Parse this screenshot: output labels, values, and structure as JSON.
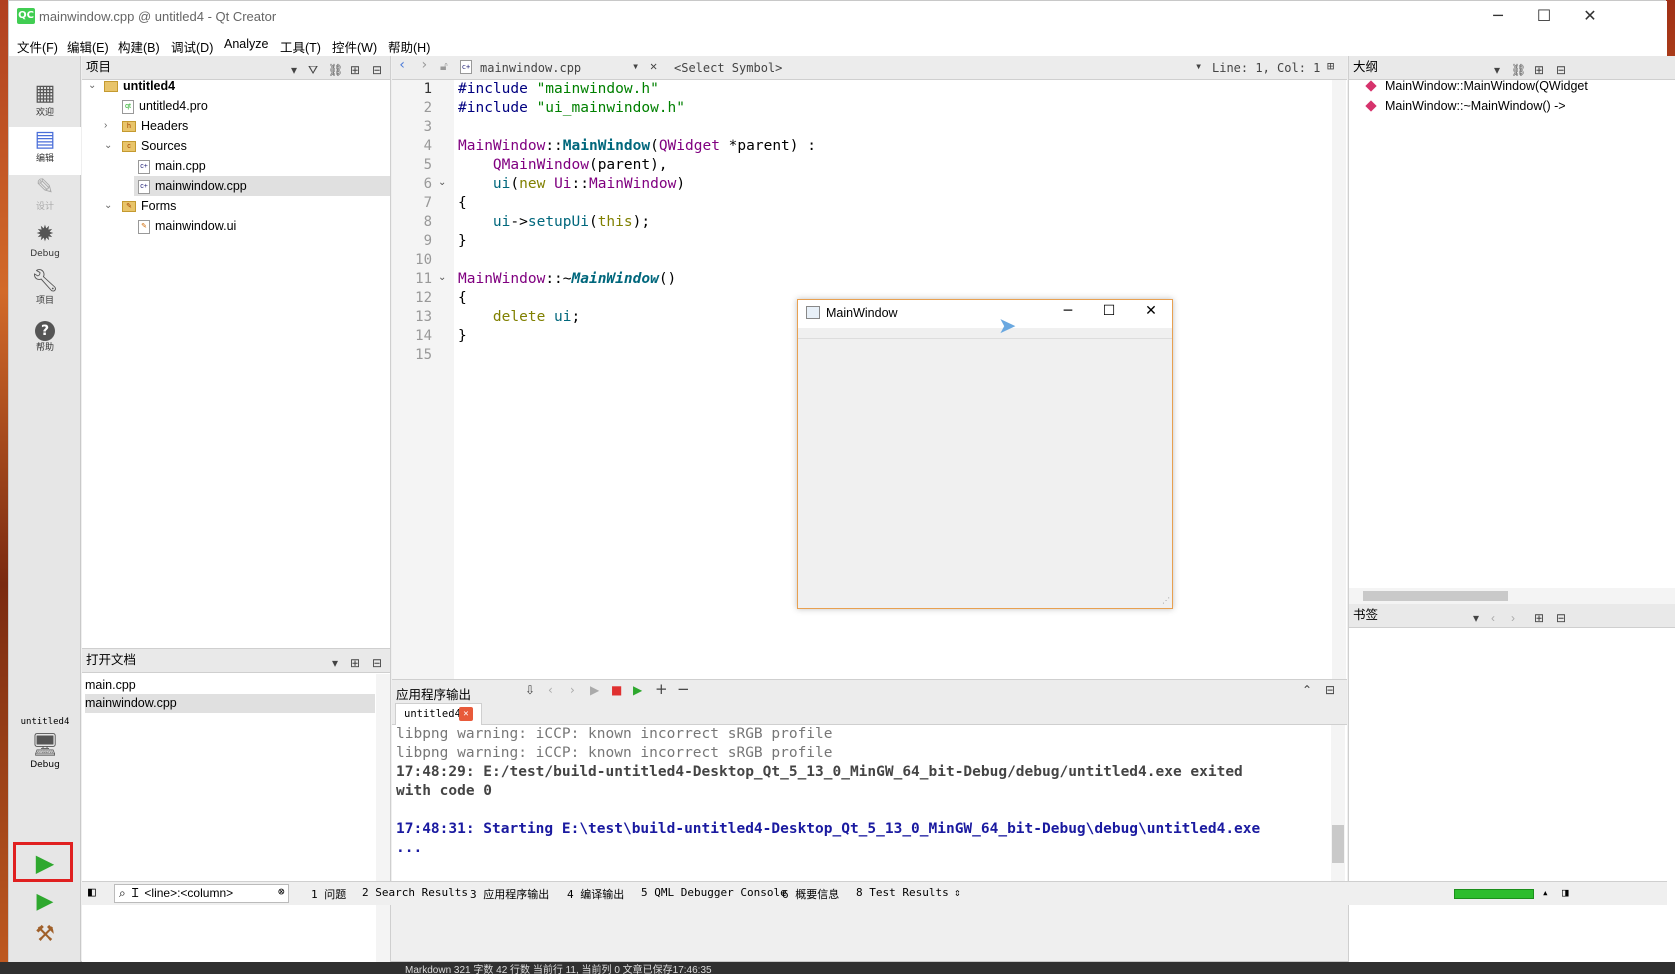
{
  "window": {
    "title": "mainwindow.cpp @ untitled4 - Qt Creator",
    "app_icon": "QC",
    "controls": {
      "minimize": "─",
      "maximize": "☐",
      "close": "✕"
    }
  },
  "menu": [
    "文件(F)",
    "编辑(E)",
    "构建(B)",
    "调试(D)",
    "Analyze",
    "工具(T)",
    "控件(W)",
    "帮助(H)"
  ],
  "modes": [
    {
      "label": "欢迎",
      "icon": "grid-icon"
    },
    {
      "label": "编辑",
      "icon": "edit-icon"
    },
    {
      "label": "设计",
      "icon": "pencil-icon"
    },
    {
      "label": "Debug",
      "icon": "bug-icon"
    },
    {
      "label": "项目",
      "icon": "wrench-icon"
    },
    {
      "label": "帮助",
      "icon": "help-icon"
    }
  ],
  "kit": {
    "project": "untitled4",
    "config": "Debug"
  },
  "project_pane": {
    "title": "项目",
    "tree": [
      {
        "label": "untitled4",
        "type": "project",
        "expanded": true
      },
      {
        "label": "untitled4.pro",
        "type": "pro"
      },
      {
        "label": "Headers",
        "type": "folder",
        "expanded": false
      },
      {
        "label": "Sources",
        "type": "folder",
        "expanded": true
      },
      {
        "label": "main.cpp",
        "type": "cpp"
      },
      {
        "label": "mainwindow.cpp",
        "type": "cpp",
        "selected": true
      },
      {
        "label": "Forms",
        "type": "folder",
        "expanded": true
      },
      {
        "label": "mainwindow.ui",
        "type": "ui"
      }
    ]
  },
  "open_docs": {
    "title": "打开文档",
    "items": [
      "main.cpp",
      "mainwindow.cpp"
    ],
    "selected": "mainwindow.cpp"
  },
  "editor": {
    "file": "mainwindow.cpp",
    "symbol": "<Select Symbol>",
    "position": "Line: 1, Col: 1",
    "line_numbers": [
      "1",
      "2",
      "3",
      "4",
      "5",
      "6",
      "7",
      "8",
      "9",
      "10",
      "11",
      "12",
      "13",
      "14",
      "15"
    ]
  },
  "outline": {
    "title": "大纲",
    "items": [
      "MainWindow::MainWindow(QWidget",
      "MainWindow::~MainWindow() ->"
    ]
  },
  "bookmarks": {
    "title": "书签"
  },
  "output_pane": {
    "title": "应用程序输出",
    "tab": "untitled4",
    "lines": [
      {
        "text": "libpng warning: iCCP: known incorrect sRGB profile",
        "style": "gray"
      },
      {
        "text": "libpng warning: iCCP: known incorrect sRGB profile",
        "style": "gray"
      },
      {
        "text": "17:48:29: E:/test/build-untitled4-Desktop_Qt_5_13_0_MinGW_64_bit-Debug/debug/untitled4.exe exited",
        "style": "bold"
      },
      {
        "text": "with code 0",
        "style": "bold"
      },
      {
        "text": "",
        "style": "gray"
      },
      {
        "text": "17:48:31: Starting E:\\test\\build-untitled4-Desktop_Qt_5_13_0_MinGW_64_bit-Debug\\debug\\untitled4.exe",
        "style": "blue"
      },
      {
        "text": "...",
        "style": "blue"
      }
    ]
  },
  "status": {
    "locator_placeholder": "Ｉ <line>:<column>",
    "tabs": [
      "1 问题",
      "2 Search Results",
      "3 应用程序输出",
      "4 编译输出",
      "5 QML Debugger Console",
      "6 概要信息",
      "8 Test Results"
    ]
  },
  "app_window": {
    "title": "MainWindow"
  },
  "taskbar": {
    "text": "Markdown  321 字数  42 行数  当前行 11, 当前列 0  文章已保存17:46:35"
  }
}
